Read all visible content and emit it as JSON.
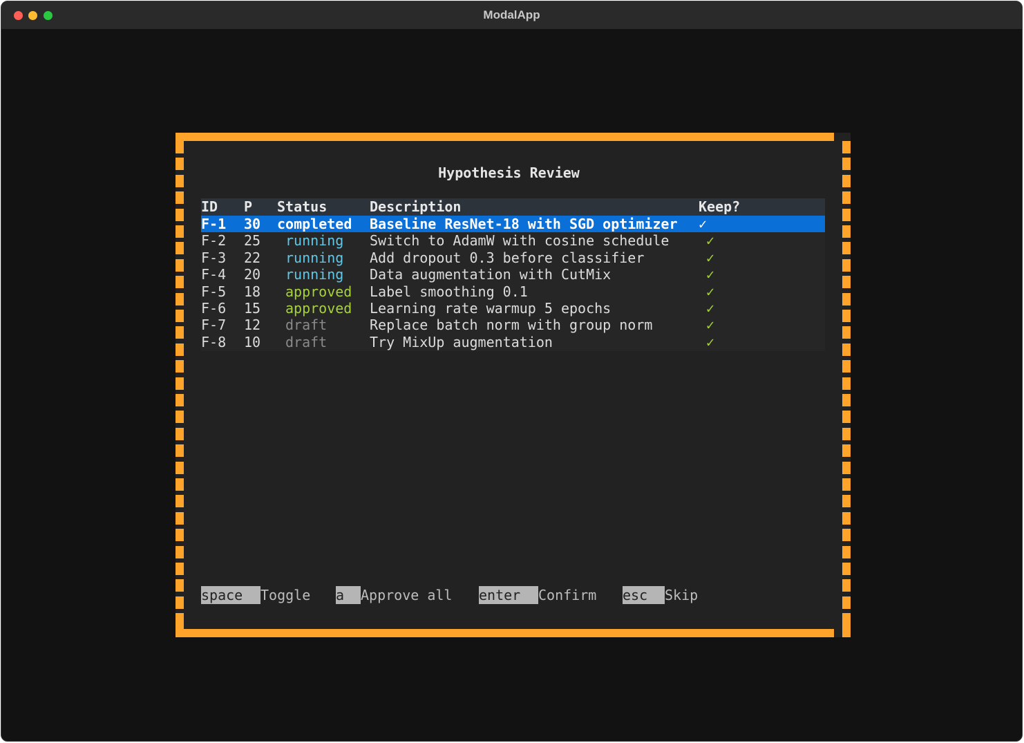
{
  "window": {
    "title": "ModalApp"
  },
  "modal": {
    "title": "Hypothesis Review",
    "columns": {
      "id": "ID",
      "p": "P",
      "status": "Status",
      "description": "Description",
      "keep": "Keep?"
    },
    "rows": [
      {
        "id": "F-1",
        "p": "30",
        "status": "completed",
        "description": "Baseline ResNet-18 with SGD optimizer",
        "keep": "✓"
      },
      {
        "id": "F-2",
        "p": "25",
        "status": "running",
        "description": "Switch to AdamW with cosine schedule",
        "keep": "✓"
      },
      {
        "id": "F-3",
        "p": "22",
        "status": "running",
        "description": "Add dropout 0.3 before classifier",
        "keep": "✓"
      },
      {
        "id": "F-4",
        "p": "20",
        "status": "running",
        "description": "Data augmentation with CutMix",
        "keep": "✓"
      },
      {
        "id": "F-5",
        "p": "18",
        "status": "approved",
        "description": "Label smoothing 0.1",
        "keep": "✓"
      },
      {
        "id": "F-6",
        "p": "15",
        "status": "approved",
        "description": "Learning rate warmup 5 epochs",
        "keep": "✓"
      },
      {
        "id": "F-7",
        "p": "12",
        "status": "draft",
        "description": "Replace batch norm with group norm",
        "keep": "✓"
      },
      {
        "id": "F-8",
        "p": "10",
        "status": "draft",
        "description": "Try MixUp augmentation",
        "keep": "✓"
      }
    ],
    "footer": [
      {
        "key": "space",
        "label": "Toggle"
      },
      {
        "key": "a",
        "label": "Approve all"
      },
      {
        "key": "enter",
        "label": "Confirm"
      },
      {
        "key": "esc",
        "label": "Skip"
      }
    ]
  },
  "colors": {
    "border": "#ffa42a",
    "selection": "#0a6fd6",
    "running": "#5fc8e8",
    "approved": "#a6d23b",
    "draft": "#8a8a8a"
  }
}
